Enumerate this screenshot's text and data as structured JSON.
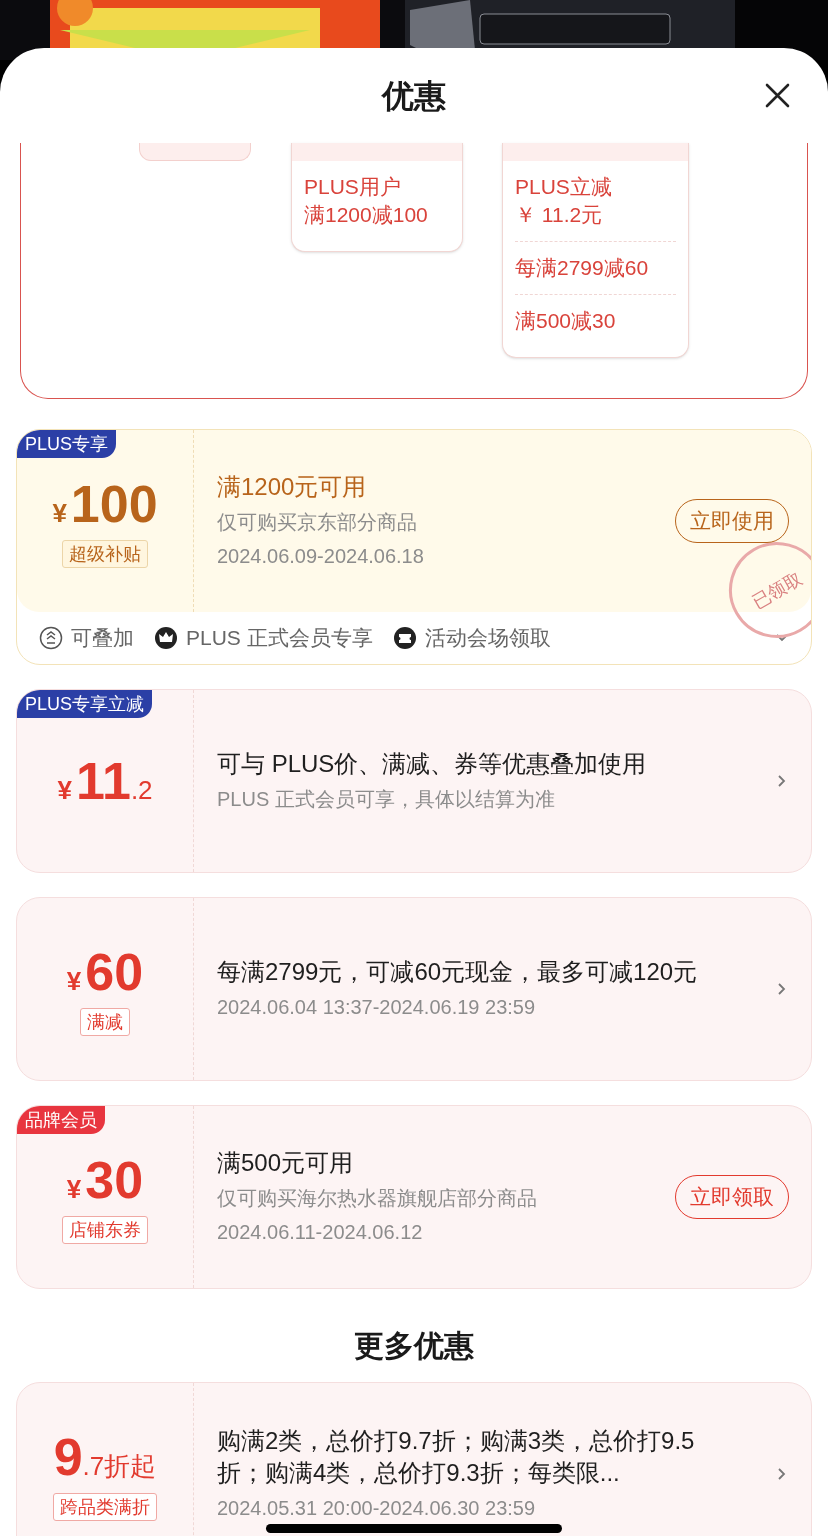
{
  "sheet": {
    "title": "优惠"
  },
  "summary": {
    "columns": [
      {
        "kind": "pill"
      },
      {
        "kind": "box",
        "items": [
          [
            "PLUS用户",
            "满1200减100"
          ]
        ]
      },
      {
        "kind": "box",
        "items": [
          [
            "PLUS立减",
            "￥ 11.2元"
          ],
          [
            "每满2799减60"
          ],
          [
            "满500减30"
          ]
        ]
      }
    ]
  },
  "coupons": [
    {
      "kind": "gold",
      "badge": {
        "text": "PLUS专享",
        "color": "#2b3fa6"
      },
      "currency": "¥",
      "amount": "100",
      "tag": "超级补贴",
      "title": "满1200元可用",
      "desc": "仅可购买京东部分商品",
      "date": "2024.06.09-2024.06.18",
      "action": {
        "kind": "button",
        "label": "立即使用"
      },
      "stamp": "已领取",
      "features": [
        {
          "kind": "stack",
          "text": "可叠加"
        },
        {
          "kind": "crown",
          "text": "PLUS 正式会员专享"
        },
        {
          "kind": "ticket",
          "text": "活动会场领取"
        }
      ]
    },
    {
      "kind": "red",
      "badge": {
        "text": "PLUS专享立减",
        "color": "#2b3fa6"
      },
      "currency": "¥",
      "amount": "11",
      "amount_suffix": ".2",
      "title": "可与 PLUS价、满减、券等优惠叠加使用",
      "desc": "PLUS 正式会员可享，具体以结算为准",
      "action": {
        "kind": "chevron"
      }
    },
    {
      "kind": "red",
      "currency": "¥",
      "amount": "60",
      "tag": "满减",
      "title": "每满2799元，可减60元现金，最多可减120元",
      "date": "2024.06.04 13:37-2024.06.19 23:59",
      "action": {
        "kind": "chevron"
      }
    },
    {
      "kind": "red",
      "badge": {
        "text": "品牌会员",
        "color": "#e8353f"
      },
      "currency": "¥",
      "amount": "30",
      "tag": "店铺东券",
      "title": "满500元可用",
      "desc": "仅可购买海尔热水器旗舰店部分商品",
      "date": "2024.06.11-2024.06.12",
      "action": {
        "kind": "button",
        "label": "立即领取"
      }
    }
  ],
  "more": {
    "title": "更多优惠",
    "coupons": [
      {
        "kind": "red",
        "amount": "9",
        "amount_suffix": ".7折起",
        "tag": "跨品类满折",
        "title": "购满2类，总价打9.7折；购满3类，总价打9.5折；购满4类，总价打9.3折；每类限...",
        "date": "2024.05.31 20:00-2024.06.30 23:59",
        "action": {
          "kind": "chevron"
        }
      }
    ]
  }
}
